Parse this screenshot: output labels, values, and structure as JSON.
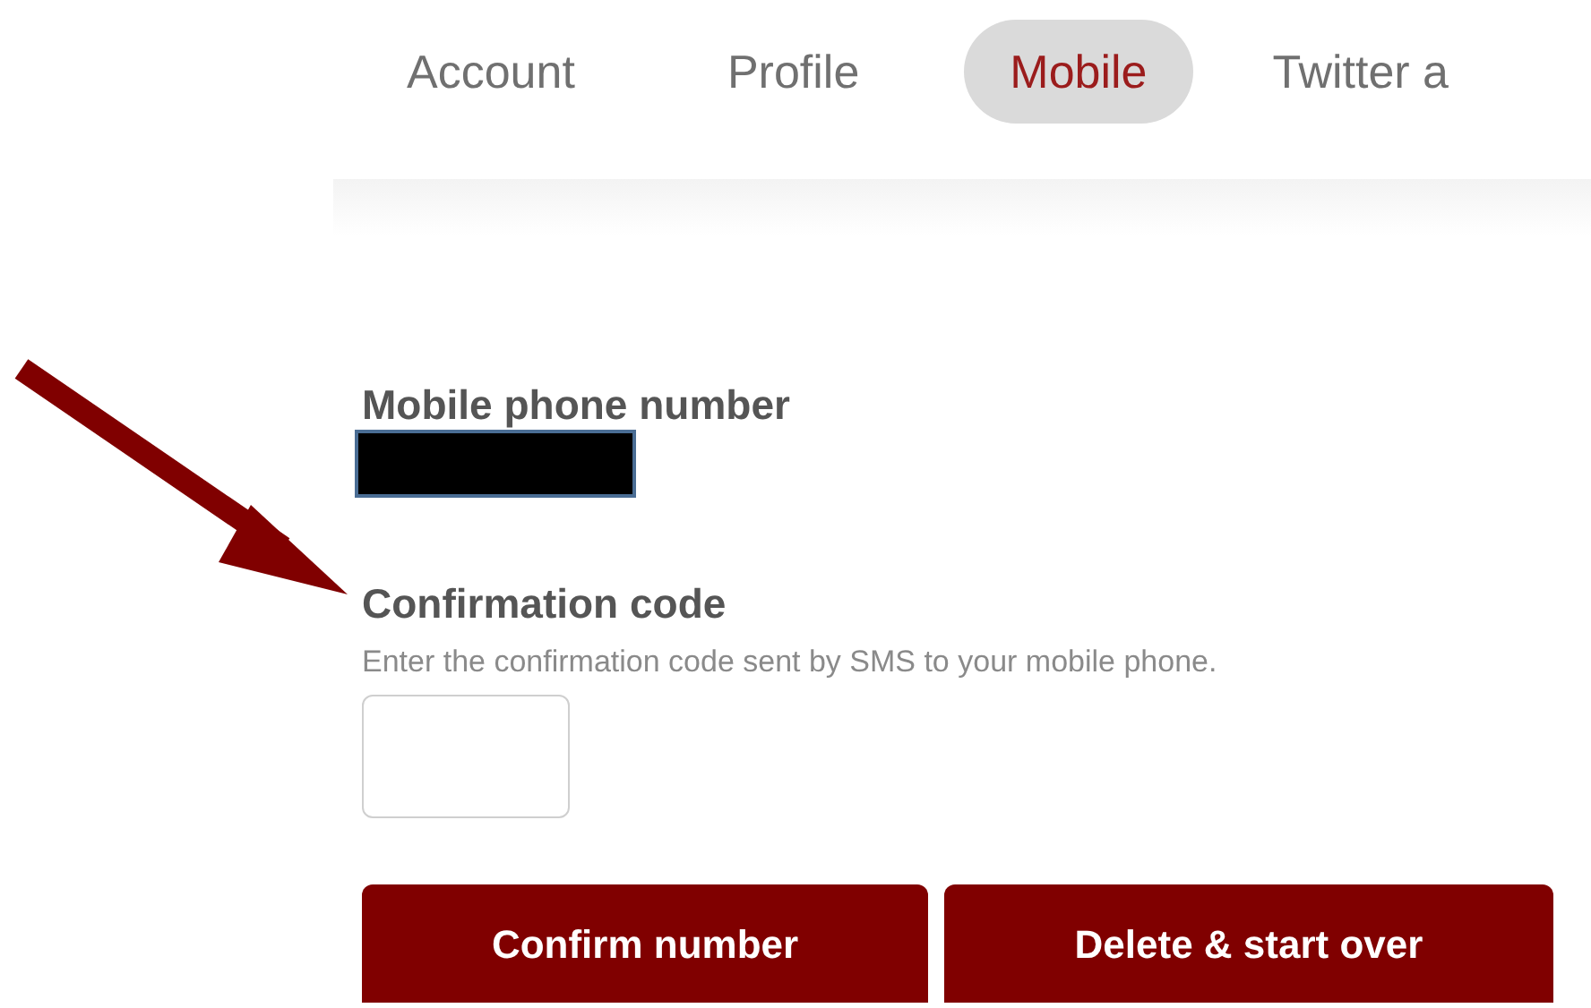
{
  "tabs": [
    {
      "label": "Account",
      "selected": false
    },
    {
      "label": "Profile",
      "selected": false
    },
    {
      "label": "Mobile",
      "selected": true
    },
    {
      "label": "Twitter a",
      "selected": false
    }
  ],
  "mobile_number": {
    "label": "Mobile phone number",
    "redacted": true
  },
  "confirmation": {
    "label": "Confirmation code",
    "hint": "Enter the confirmation code sent by SMS to your mobile phone."
  },
  "buttons": [
    "Confirm number",
    "Delete & start over"
  ]
}
